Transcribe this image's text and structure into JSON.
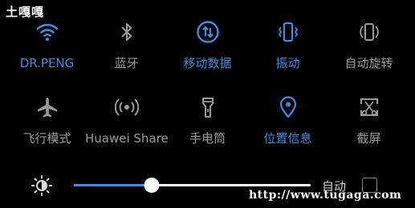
{
  "status": {
    "title": "土嘎嘎"
  },
  "accent_color": "#3b8de6",
  "toggles": [
    {
      "label": "DR.PENG",
      "icon": "wifi-icon",
      "active": true
    },
    {
      "label": "蓝牙",
      "icon": "bluetooth-icon",
      "active": false
    },
    {
      "label": "移动数据",
      "icon": "mobile-data-icon",
      "active": true
    },
    {
      "label": "振动",
      "icon": "vibrate-icon",
      "active": true
    },
    {
      "label": "自动旋转",
      "icon": "auto-rotate-icon",
      "active": false
    },
    {
      "label": "飞行模式",
      "icon": "airplane-icon",
      "active": false
    },
    {
      "label": "Huawei Share",
      "icon": "huawei-share-icon",
      "active": false
    },
    {
      "label": "手电筒",
      "icon": "flashlight-icon",
      "active": false
    },
    {
      "label": "位置信息",
      "icon": "location-icon",
      "active": true
    },
    {
      "label": "截屏",
      "icon": "screenshot-icon",
      "active": false
    }
  ],
  "brightness": {
    "level": 0.33,
    "auto_label": "自动",
    "auto_checked": false
  },
  "watermark": "http://www.tugaga.com"
}
